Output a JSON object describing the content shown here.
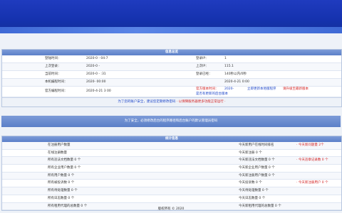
{
  "app": {
    "accent": "#1532ae",
    "panel_head": "#6b8dd0"
  },
  "system_panel": {
    "title": "信息总览",
    "rows": [
      {
        "left_label": "登陆时间：",
        "left_value": "2020-0  -  04:7",
        "right_label": "登录IP：",
        "right_value": "1"
      },
      {
        "left_label": "上次登录：",
        "left_value": "2020-0  -  ",
        "right_label": "上次IP：",
        "right_value": "115.1"
      },
      {
        "left_label": "当前时间：",
        "left_value": "2020-0  -  :31",
        "right_label": "登录已经：",
        "right_value": "140秒以内/0秒"
      },
      {
        "left_label": "本机编程时间：",
        "left_value": "2020-   00:00",
        "right_label": "",
        "right_value": "2020-4-21 0:00"
      },
      {
        "left_label": "官方编程时间：",
        "left_value": "2020-4-21 3  00",
        "right_label": "官方版本时间：",
        "right_value": "2020-"
      }
    ],
    "row5_links": [
      "立即更新本地版程序",
      "请升级至最新版本"
    ],
    "row5_extra": "是否有更新的后台版本",
    "notice_left": "为了您的账户安全，建议您定期修改密码",
    "notice_right": "· 以保障服务器更多功能正常运行 ·"
  },
  "banner": {
    "text": "为了安全，必须修改后台的程序路径和后台账户的默认管理员密码"
  },
  "stats_panel": {
    "title": "统计信息",
    "rows": [
      {
        "left": "在注册用户数量",
        "right": "今天新用户在线时间排名",
        "extra": "· 今天新问题量 2个"
      },
      {
        "left": "在线注册数量",
        "right": "今天新注册 0 个",
        "extra": ""
      },
      {
        "left": "所有违法文档数量 0 个",
        "right": "今天新违法文档数量 0 个",
        "extra": "· 今天违章记录数 0 个"
      },
      {
        "left": "所有企业用户数量 0 个",
        "right": "今天新企业用户数量 0 个",
        "extra": ""
      },
      {
        "left": "所有用户数量 0 个",
        "right": "今天新注册用户数量 0 个",
        "extra": ""
      },
      {
        "left": "所有被投诉数 0 个",
        "right": "今天投诉数 0 个",
        "extra": "· 今天新注册用户 0 个"
      },
      {
        "left": "所有待处理数量 0 个",
        "right": "今天待处理数量 0 个",
        "extra": ""
      },
      {
        "left": "所有日志数量 0 个",
        "right": "今天日志数量 0 个",
        "extra": ""
      },
      {
        "left": "所有租用代理的总数量 0 个",
        "right": "今天新租用代理的总数量 0 个",
        "extra": ""
      }
    ]
  },
  "footer": {
    "text": "版权所有 © 2020"
  }
}
